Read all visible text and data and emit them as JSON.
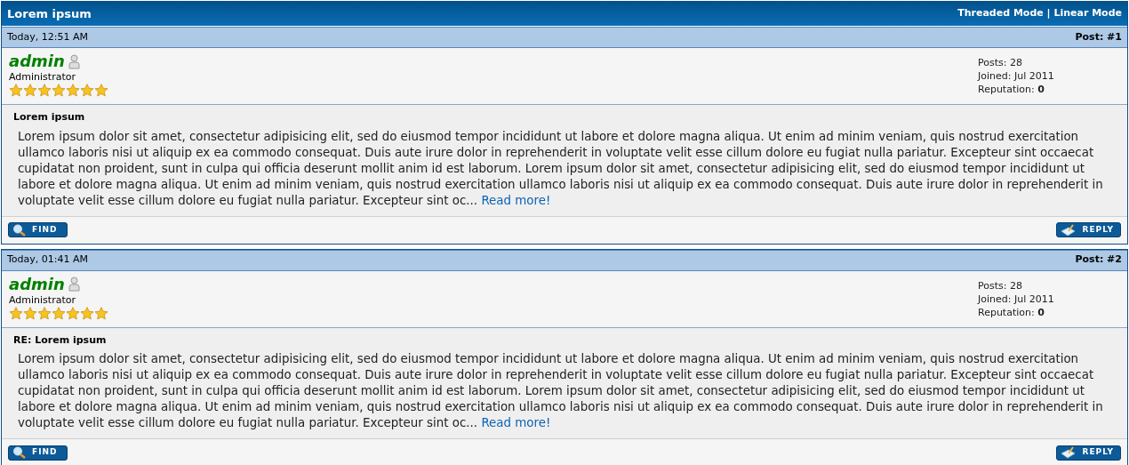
{
  "thread": {
    "title": "Lorem ipsum",
    "modes": "Threaded Mode | Linear Mode"
  },
  "posts": [
    {
      "date": "Today, 12:51 AM",
      "number": "Post: #1",
      "author": "admin",
      "role": "Administrator",
      "stars": 7,
      "stats": [
        "Posts: 28",
        "Joined: Jul 2011",
        "Reputation: **0**"
      ],
      "subject": "Lorem ipsum",
      "body": "Lorem ipsum dolor sit amet, consectetur adipisicing elit, sed do eiusmod tempor incididunt ut labore et dolore magna aliqua. Ut enim ad minim veniam, quis nostrud exercitation ullamco laboris nisi ut aliquip ex ea commodo consequat. Duis aute irure dolor in reprehenderit in voluptate velit esse cillum dolore eu fugiat nulla pariatur. Excepteur sint occaecat cupidatat non proident, sunt in culpa qui officia deserunt mollit anim id est laborum. Lorem ipsum dolor sit amet, consectetur adipisicing elit, sed do eiusmod tempor incididunt ut labore et dolore magna aliqua. Ut enim ad minim veniam, quis nostrud exercitation ullamco laboris nisi ut aliquip ex ea commodo consequat. Duis aute irure dolor in reprehenderit in voluptate velit esse cillum dolore eu fugiat nulla pariatur. Excepteur sint oc...",
      "more": "Read more!",
      "find": "FIND",
      "reply": "REPLY"
    },
    {
      "date": "Today, 01:41 AM",
      "number": "Post: #2",
      "author": "admin",
      "role": "Administrator",
      "stars": 7,
      "stats": [
        "Posts: 28",
        "Joined: Jul 2011",
        "Reputation: **0**"
      ],
      "subject": "RE: Lorem ipsum",
      "body": "Lorem ipsum dolor sit amet, consectetur adipisicing elit, sed do eiusmod tempor incididunt ut labore et dolore magna aliqua. Ut enim ad minim veniam, quis nostrud exercitation ullamco laboris nisi ut aliquip ex ea commodo consequat. Duis aute irure dolor in reprehenderit in voluptate velit esse cillum dolore eu fugiat nulla pariatur. Excepteur sint occaecat cupidatat non proident, sunt in culpa qui officia deserunt mollit anim id est laborum. Lorem ipsum dolor sit amet, consectetur adipisicing elit, sed do eiusmod tempor incididunt ut labore et dolore magna aliqua. Ut enim ad minim veniam, quis nostrud exercitation ullamco laboris nisi ut aliquip ex ea commodo consequat. Duis aute irure dolor in reprehenderit in voluptate velit esse cillum dolore eu fugiat nulla pariatur. Excepteur sint oc...",
      "more": "Read more!",
      "find": "FIND",
      "reply": "REPLY"
    }
  ]
}
